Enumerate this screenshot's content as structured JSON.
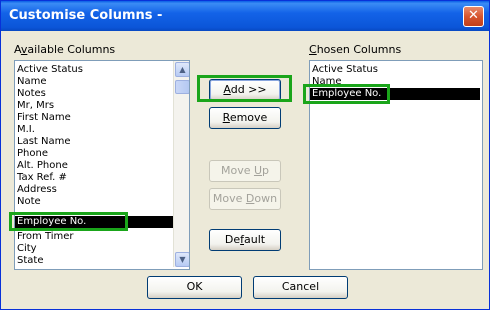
{
  "dialog": {
    "title": "Customise Columns -",
    "close_glyph": "✕"
  },
  "available": {
    "label_prefix": "A",
    "label_mnemonic": "v",
    "label_suffix": "ailable Columns",
    "items": [
      "Active Status",
      "Name",
      "Notes",
      "Mr, Mrs",
      "First Name",
      "M.I.",
      "Last Name",
      "Phone",
      "Alt. Phone",
      "Tax Ref. #",
      "Address",
      "Note",
      "Employee No.",
      "From Timer",
      "City",
      "State"
    ],
    "selected": "Employee No."
  },
  "chosen": {
    "label_prefix": "",
    "label_mnemonic": "C",
    "label_suffix": "hosen Columns",
    "items": [
      "Active Status",
      "Name",
      "Employee No."
    ],
    "selected": "Employee No."
  },
  "buttons": {
    "add": {
      "pre": "",
      "mn": "A",
      "post": "dd >>"
    },
    "remove": {
      "pre": "",
      "mn": "R",
      "post": "emove"
    },
    "move_up": {
      "pre": "Move ",
      "mn": "U",
      "post": "p"
    },
    "move_down": {
      "pre": "Move ",
      "mn": "D",
      "post": "own"
    },
    "default": {
      "pre": "De",
      "mn": "f",
      "post": "ault"
    },
    "ok": "OK",
    "cancel": "Cancel"
  },
  "scrollbar": {
    "up_glyph": "▲",
    "down_glyph": "▼"
  },
  "colors": {
    "highlight": "#1aa51a",
    "title_bar": "#0b55d8",
    "selection": "#000000"
  }
}
